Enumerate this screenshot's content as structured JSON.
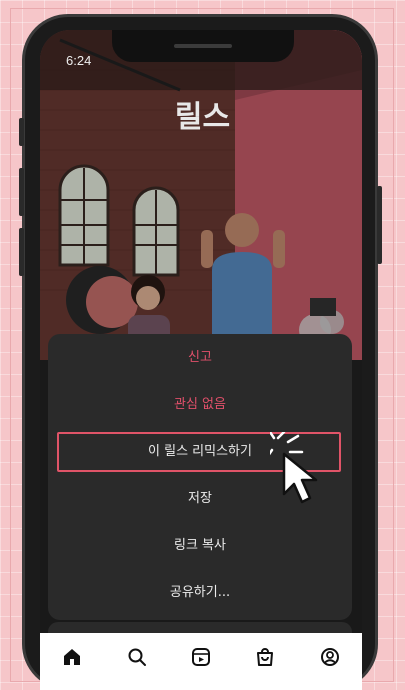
{
  "status_bar": {
    "time": "6:24"
  },
  "header": {
    "title": "릴스"
  },
  "menu": {
    "items": [
      {
        "label": "신고",
        "color": "#e0506a"
      },
      {
        "label": "관심 없음",
        "color": "#e0506a"
      },
      {
        "label": "이 릴스 리믹스하기",
        "highlighted": true
      },
      {
        "label": "저장"
      },
      {
        "label": "링크 복사"
      },
      {
        "label": "공유하기..."
      }
    ]
  },
  "tabbar": {
    "tabs": [
      {
        "icon": "home-icon",
        "active": true
      },
      {
        "icon": "search-icon"
      },
      {
        "icon": "reels-icon"
      },
      {
        "icon": "shop-icon"
      },
      {
        "icon": "profile-icon"
      }
    ]
  },
  "colors": {
    "accent": "#e05468",
    "sheet": "#2a2a2a",
    "background": "#f6c6c9"
  }
}
